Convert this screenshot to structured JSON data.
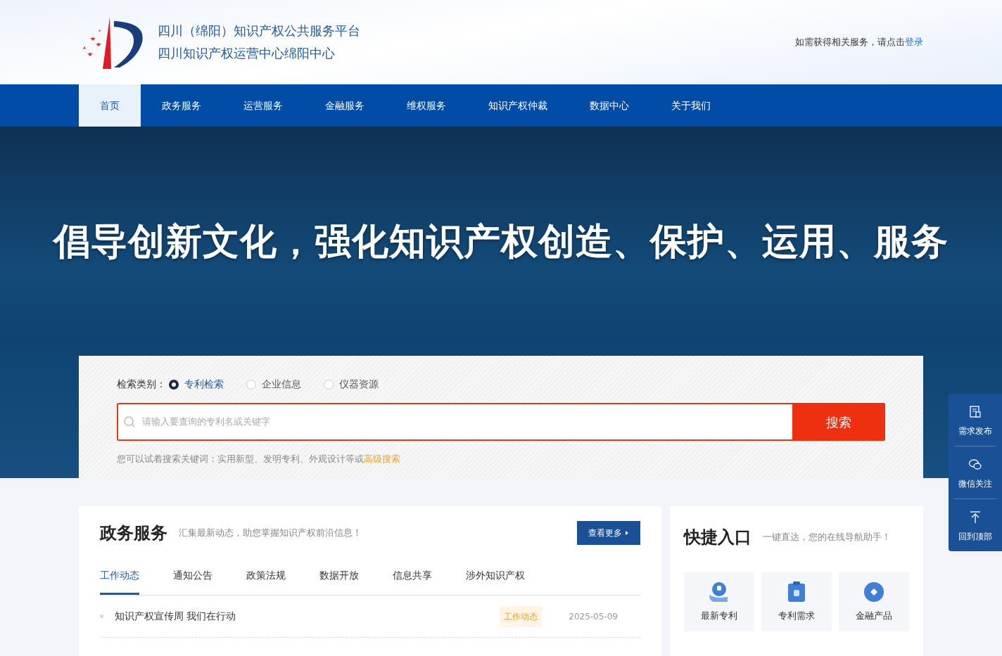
{
  "header": {
    "title_lines": [
      "四川（绵阳）知识产权公共服务平台",
      "四川知识产权运营中心绵阳中心"
    ],
    "login_prompt": "如需获得相关服务，请点击",
    "login_link": "登录"
  },
  "nav": [
    {
      "label": "首页",
      "selected": true
    },
    {
      "label": "政务服务",
      "selected": false
    },
    {
      "label": "运营服务",
      "selected": false
    },
    {
      "label": "金融服务",
      "selected": false
    },
    {
      "label": "维权服务",
      "selected": false
    },
    {
      "label": "知识产权仲裁",
      "selected": false
    },
    {
      "label": "数据中心",
      "selected": false
    },
    {
      "label": "关于我们",
      "selected": false
    }
  ],
  "banner": {
    "slogan": "倡导创新文化，强化知识产权创造、保护、运用、服务"
  },
  "search": {
    "label": "检索类别：",
    "categories": [
      {
        "label": "专利检索",
        "selected": true
      },
      {
        "label": "企业信息",
        "selected": false
      },
      {
        "label": "仪器资源",
        "selected": false
      }
    ],
    "placeholder": "请输入要查询的专利名或关键字",
    "button": "搜索",
    "hint": "您可以试着搜索关键词：实用新型、发明专利、外观设计等或",
    "hint_link": "高级搜索"
  },
  "gov_services": {
    "title": "政务服务",
    "subtitle": "汇集最新动态，助您掌握知识产权前沿信息！",
    "more_button": "查看更多",
    "tabs": [
      {
        "label": "工作动态",
        "selected": true
      },
      {
        "label": "通知公告",
        "selected": false
      },
      {
        "label": "政策法规",
        "selected": false
      },
      {
        "label": "数据开放",
        "selected": false
      },
      {
        "label": "信息共享",
        "selected": false
      },
      {
        "label": "涉外知识产权",
        "selected": false
      }
    ],
    "items": [
      {
        "title": "知识产权宣传周 我们在行动",
        "tag": "工作动态",
        "date": "2025-05-09"
      }
    ]
  },
  "quick_entry": {
    "title": "快捷入口",
    "subtitle": "一键直达，您的在线导航助手！",
    "items": [
      {
        "label": "最新专利",
        "kind": "patent-hand"
      },
      {
        "label": "专利需求",
        "kind": "patent-clipboard"
      },
      {
        "label": "金融产品",
        "kind": "finance"
      }
    ]
  },
  "side_tools": [
    {
      "label": "需求发布",
      "kind": "form"
    },
    {
      "label": "微信关注",
      "kind": "chat"
    },
    {
      "label": "回到顶部",
      "kind": "top"
    }
  ]
}
